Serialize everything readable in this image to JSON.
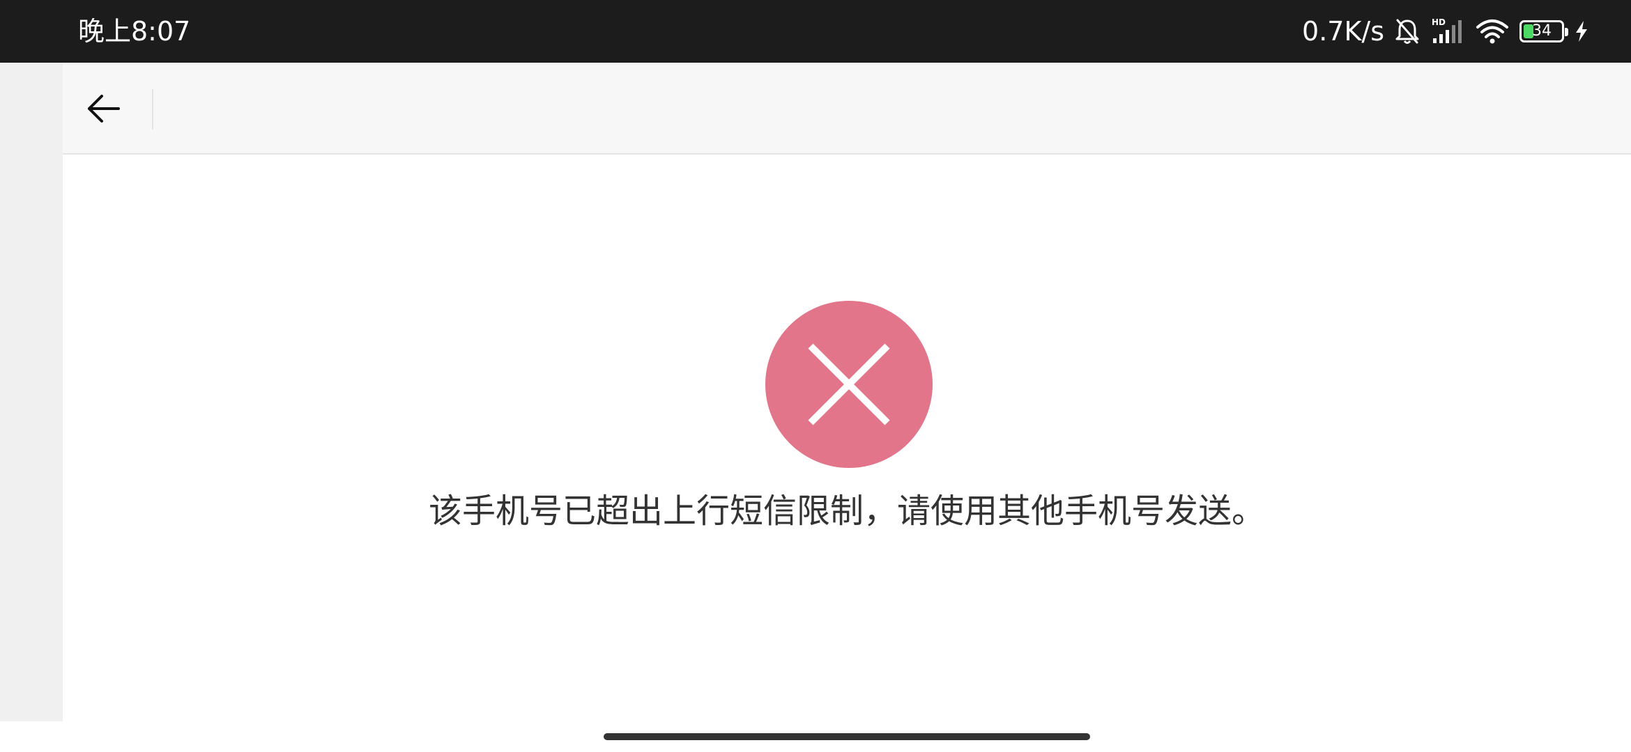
{
  "status_bar": {
    "time": "晚上8:07",
    "net_speed": "0.7K/s",
    "battery_level": "34",
    "hd_label": "HD",
    "icons": [
      "mute-bell-icon",
      "signal-icon",
      "wifi-icon",
      "battery-icon",
      "charging-icon"
    ]
  },
  "header": {
    "back_icon": "arrow-left-icon"
  },
  "main": {
    "status_icon": "error-x-icon",
    "status_color": "#e27589",
    "message": "该手机号已超出上行短信限制，请使用其他手机号发送。"
  }
}
